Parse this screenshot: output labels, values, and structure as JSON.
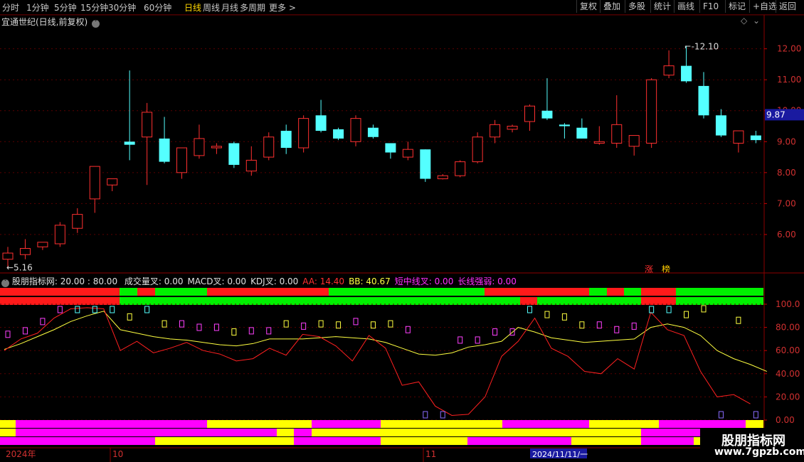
{
  "toolbar": {
    "periods": [
      "分时",
      "1分钟",
      "5分钟",
      "15分钟",
      "30分钟",
      "60分钟",
      "日线",
      "周线",
      "月线",
      "多周期",
      "更多 >"
    ],
    "active_period": "日线",
    "tools": [
      "复权",
      "叠加",
      "多股",
      "统计",
      "画线",
      "F10",
      "标记",
      "+自选",
      "返回"
    ]
  },
  "main": {
    "title": "宜通世纪(日线,前复权)",
    "price_axis": [
      "12.00",
      "11.00",
      "10.00",
      "9.00",
      "8.00",
      "7.00",
      "6.00"
    ],
    "current_price": "9.87",
    "high_label": "12.10",
    "low_label": "5.16",
    "tags": [
      "涨",
      "榜"
    ]
  },
  "indicator": {
    "name": "股朋指标网",
    "params": ": 20.00 : 80.00",
    "items": [
      {
        "label": "成交量叉: 0.00",
        "color": "#e0e0e0"
      },
      {
        "label": "MACD叉: 0.00",
        "color": "#e0e0e0"
      },
      {
        "label": "KDJ叉: 0.00",
        "color": "#e0e0e0"
      },
      {
        "label": "AA: 14.40",
        "color": "#ff3030"
      },
      {
        "label": "BB: 40.67",
        "color": "#ffff40"
      },
      {
        "label": "短中线叉: 0.00",
        "color": "#ff30ff"
      },
      {
        "label": "长线强弱: 0.00",
        "color": "#ff30ff"
      }
    ],
    "axis": [
      "100.0",
      "80.00",
      "60.00",
      "40.00",
      "20.00",
      "0.00"
    ]
  },
  "dates": {
    "left": "2024年",
    "m1": "10",
    "m2": "11",
    "cursor": "2024/11/11/一"
  },
  "watermark": {
    "name": "股朋指标网",
    "url": "www.7gpzb.com"
  },
  "colors": {
    "up": "#ff3030",
    "down": "#54ffff",
    "aa": "#ff2020",
    "bb": "#ffff40",
    "green": "#00ff00",
    "magenta": "#ff00ff",
    "yellow": "#ffff00"
  },
  "chart_data": {
    "type": "candlestick",
    "candles": [
      {
        "o": 5.2,
        "h": 5.6,
        "l": 4.9,
        "c": 5.4
      },
      {
        "o": 5.35,
        "h": 5.85,
        "l": 5.2,
        "c": 5.55
      },
      {
        "o": 5.6,
        "h": 5.75,
        "l": 5.5,
        "c": 5.75
      },
      {
        "o": 5.7,
        "h": 6.4,
        "l": 5.6,
        "c": 6.3
      },
      {
        "o": 6.2,
        "h": 6.85,
        "l": 6.05,
        "c": 6.65
      },
      {
        "o": 7.15,
        "h": 8.2,
        "l": 6.7,
        "c": 8.2
      },
      {
        "o": 7.6,
        "h": 7.8,
        "l": 7.4,
        "c": 7.8
      },
      {
        "o": 9.0,
        "h": 11.3,
        "l": 8.4,
        "c": 8.9
      },
      {
        "o": 9.15,
        "h": 10.25,
        "l": 7.6,
        "c": 9.95
      },
      {
        "o": 9.1,
        "h": 9.8,
        "l": 8.3,
        "c": 8.35
      },
      {
        "o": 8.0,
        "h": 8.8,
        "l": 7.8,
        "c": 8.8
      },
      {
        "o": 8.55,
        "h": 9.55,
        "l": 8.45,
        "c": 9.1
      },
      {
        "o": 8.8,
        "h": 8.95,
        "l": 8.6,
        "c": 8.85
      },
      {
        "o": 8.95,
        "h": 9.0,
        "l": 8.15,
        "c": 8.25
      },
      {
        "o": 8.05,
        "h": 8.85,
        "l": 7.9,
        "c": 8.4
      },
      {
        "o": 8.5,
        "h": 9.3,
        "l": 8.4,
        "c": 9.15
      },
      {
        "o": 9.35,
        "h": 9.55,
        "l": 8.6,
        "c": 8.8
      },
      {
        "o": 8.8,
        "h": 9.85,
        "l": 8.65,
        "c": 9.75
      },
      {
        "o": 9.85,
        "h": 10.35,
        "l": 9.3,
        "c": 9.35
      },
      {
        "o": 9.4,
        "h": 9.45,
        "l": 9.05,
        "c": 9.1
      },
      {
        "o": 9.0,
        "h": 9.85,
        "l": 8.85,
        "c": 9.75
      },
      {
        "o": 9.45,
        "h": 9.55,
        "l": 9.1,
        "c": 9.15
      },
      {
        "o": 8.95,
        "h": 8.95,
        "l": 8.45,
        "c": 8.65
      },
      {
        "o": 8.5,
        "h": 9.0,
        "l": 8.4,
        "c": 8.75
      },
      {
        "o": 8.75,
        "h": 8.75,
        "l": 7.7,
        "c": 7.8
      },
      {
        "o": 7.8,
        "h": 7.95,
        "l": 7.78,
        "c": 7.9
      },
      {
        "o": 7.9,
        "h": 8.4,
        "l": 7.85,
        "c": 8.35
      },
      {
        "o": 8.35,
        "h": 9.3,
        "l": 8.3,
        "c": 9.15
      },
      {
        "o": 9.15,
        "h": 9.7,
        "l": 8.95,
        "c": 9.55
      },
      {
        "o": 9.4,
        "h": 9.55,
        "l": 9.3,
        "c": 9.5
      },
      {
        "o": 9.65,
        "h": 10.2,
        "l": 9.35,
        "c": 10.15
      },
      {
        "o": 10.0,
        "h": 11.05,
        "l": 9.7,
        "c": 9.75
      },
      {
        "o": 9.55,
        "h": 9.6,
        "l": 9.1,
        "c": 9.5
      },
      {
        "o": 9.45,
        "h": 9.75,
        "l": 9.1,
        "c": 9.1
      },
      {
        "o": 8.95,
        "h": 9.5,
        "l": 8.9,
        "c": 9.0
      },
      {
        "o": 8.95,
        "h": 10.5,
        "l": 8.8,
        "c": 9.55
      },
      {
        "o": 8.85,
        "h": 9.2,
        "l": 8.55,
        "c": 9.2
      },
      {
        "o": 8.95,
        "h": 11.05,
        "l": 8.8,
        "c": 11.0
      },
      {
        "o": 11.15,
        "h": 11.95,
        "l": 11.05,
        "c": 11.45
      },
      {
        "o": 11.45,
        "h": 12.1,
        "l": 10.9,
        "c": 10.95
      },
      {
        "o": 10.8,
        "h": 11.25,
        "l": 9.75,
        "c": 9.85
      },
      {
        "o": 9.85,
        "h": 10.05,
        "l": 9.15,
        "c": 9.2
      },
      {
        "o": 8.95,
        "h": 9.3,
        "l": 8.65,
        "c": 9.35
      },
      {
        "o": 9.2,
        "h": 9.35,
        "l": 8.95,
        "c": 9.05
      }
    ],
    "price_range": [
      4.85,
      12.75
    ],
    "aa": [
      60,
      70,
      75,
      88,
      96,
      97,
      96,
      60,
      68,
      58,
      62,
      67,
      60,
      57,
      51,
      53,
      62,
      56,
      74,
      72,
      64,
      51,
      73,
      62,
      30,
      33,
      12,
      4,
      5,
      20,
      55,
      68,
      88,
      62,
      55,
      42,
      40,
      53,
      44,
      93,
      78,
      73,
      42,
      20,
      22,
      14
    ],
    "bb": [
      61,
      66,
      72,
      78,
      85,
      90,
      94,
      78,
      75,
      72,
      70,
      69,
      67,
      65,
      64,
      66,
      70,
      70,
      70,
      71,
      72,
      71,
      70,
      67,
      62,
      57,
      56,
      58,
      63,
      65,
      68,
      80,
      76,
      71,
      69,
      67,
      68,
      69,
      70,
      80,
      83,
      80,
      73,
      60,
      53,
      48,
      42
    ],
    "cross_top_idx": [
      3,
      4,
      5,
      6,
      8,
      30,
      37,
      38
    ],
    "cross_bottom_idx": [
      24,
      25,
      41,
      43
    ],
    "osc_range": [
      0,
      115
    ]
  }
}
